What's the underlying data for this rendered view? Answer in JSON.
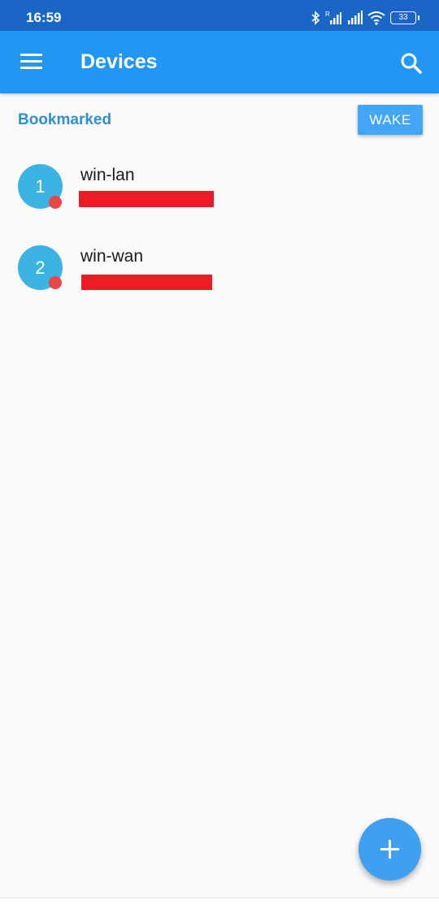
{
  "status_bar": {
    "time": "16:59",
    "battery_level": "33",
    "icons": [
      "bluetooth-icon",
      "cellular-signal-icon",
      "cellular-signal-icon",
      "wifi-icon",
      "battery-icon"
    ]
  },
  "app_bar": {
    "title": "Devices",
    "menu_icon": "hamburger-menu-icon",
    "search_icon": "search-icon",
    "color": "#2196f3"
  },
  "section": {
    "title": "Bookmarked",
    "wake_label": "WAKE"
  },
  "devices": [
    {
      "index": "1",
      "name": "win-lan",
      "status_color": "#ec4545"
    },
    {
      "index": "2",
      "name": "win-wan",
      "status_color": "#ec4545"
    }
  ],
  "fab": {
    "icon": "plus-icon"
  },
  "colors": {
    "accent": "#2f8fcf",
    "avatar": "#3bb3e3",
    "status_offline": "#ec4545",
    "redaction": "#ed1c24"
  }
}
